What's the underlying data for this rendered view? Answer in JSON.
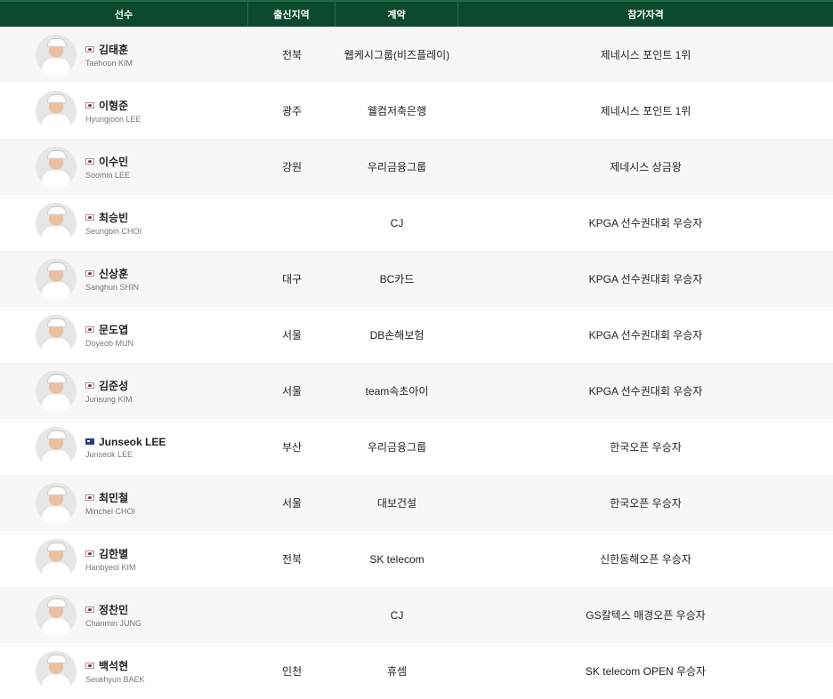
{
  "table": {
    "headers": [
      "선수",
      "출신지역",
      "계약",
      "참가자격"
    ]
  },
  "colors": {
    "header_bg": "#0b4a2e",
    "row_alt_bg": "#f7f7f7"
  },
  "rows": [
    {
      "name_ko": "김태훈",
      "name_en": "Taehoon KIM",
      "region": "전북",
      "contract": "웹케시그룹(비즈플레이)",
      "qualification": "제네시스 포인트 1위",
      "flag": "kr-flag-icon"
    },
    {
      "name_ko": "이형준",
      "name_en": "Hyungjoon LEE",
      "region": "광주",
      "contract": "웰컴저축은행",
      "qualification": "제네시스 포인트 1위",
      "flag": "kr-flag-icon"
    },
    {
      "name_ko": "이수민",
      "name_en": "Soomin LEE",
      "region": "강원",
      "contract": "우리금융그룹",
      "qualification": "제네시스 상금왕",
      "flag": "kr-flag-icon"
    },
    {
      "name_ko": "최승빈",
      "name_en": "Seungbin CHOI",
      "region": "",
      "contract": "CJ",
      "qualification": "KPGA 선수권대회 우승자",
      "flag": "kr-flag-icon"
    },
    {
      "name_ko": "신상훈",
      "name_en": "Sanghun SHIN",
      "region": "대구",
      "contract": "BC카드",
      "qualification": "KPGA 선수권대회 우승자",
      "flag": "kr-flag-icon"
    },
    {
      "name_ko": "문도엽",
      "name_en": "Doyeob MUN",
      "region": "서울",
      "contract": "DB손해보험",
      "qualification": "KPGA 선수권대회 우승자",
      "flag": "kr-flag-icon"
    },
    {
      "name_ko": "김준성",
      "name_en": "Junsung KIM",
      "region": "서울",
      "contract": "team속초아이",
      "qualification": "KPGA 선수권대회 우승자",
      "flag": "kr-flag-icon"
    },
    {
      "name_ko": "Junseok LEE",
      "name_en": "Junseok LEE",
      "region": "부산",
      "contract": "우리금융그룹",
      "qualification": "한국오픈 우승자",
      "flag": "au-flag-icon"
    },
    {
      "name_ko": "최민철",
      "name_en": "Minchel CHOI",
      "region": "서울",
      "contract": "대보건설",
      "qualification": "한국오픈 우승자",
      "flag": "kr-flag-icon"
    },
    {
      "name_ko": "김한별",
      "name_en": "Hanbyeol KIM",
      "region": "전북",
      "contract": "SK telecom",
      "qualification": "신한동해오픈 우승자",
      "flag": "kr-flag-icon"
    },
    {
      "name_ko": "정찬민",
      "name_en": "Chanmin JUNG",
      "region": "",
      "contract": "CJ",
      "qualification": "GS칼텍스 매경오픈 우승자",
      "flag": "kr-flag-icon"
    },
    {
      "name_ko": "백석현",
      "name_en": "Seukhyun BAEK",
      "region": "인천",
      "contract": "휴셈",
      "qualification": "SK telecom OPEN 우승자",
      "flag": "kr-flag-icon"
    }
  ]
}
